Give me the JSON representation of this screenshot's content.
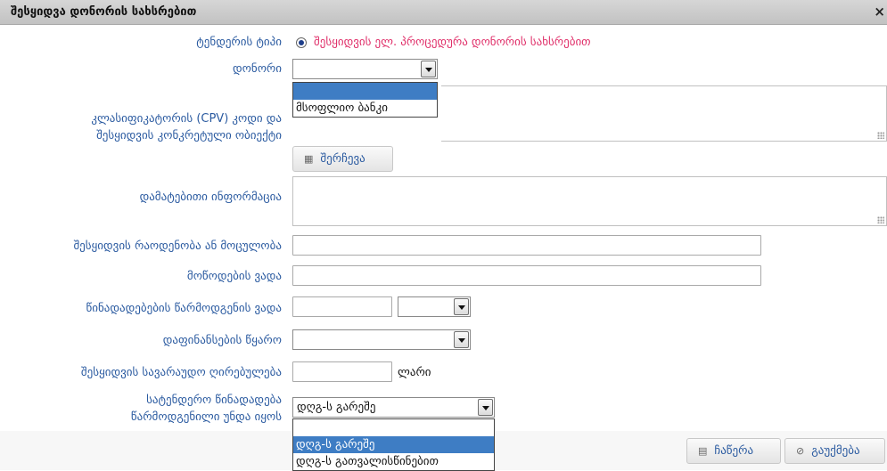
{
  "dialog": {
    "title": "შესყიდვა დონორის სახსრებით",
    "close_glyph": "×"
  },
  "form": {
    "tender_type": {
      "label": "ტენდერის ტიპი",
      "value": "შესყიდვის ელ. პროცედურა დონორის სახსრებით"
    },
    "donor": {
      "label": "დონორი",
      "value": "",
      "options": [
        "",
        "მსოფლიო ბანკი"
      ]
    },
    "cpv": {
      "label_line1": "კლასიფიკატორის (CPV) კოდი და",
      "label_line2": "შესყიდვის კონკრეტული ობიექტი",
      "choose_button": "შერჩევა"
    },
    "additional_info": {
      "label": "დამატებითი ინფორმაცია"
    },
    "quantity": {
      "label": "შესყიდვის რაოდენობა ან მოცულობა",
      "value": ""
    },
    "delivery_term": {
      "label": "მოწოდების ვადა",
      "value": ""
    },
    "proposal_deadline": {
      "label": "წინადადებების წარმოდგენის ვადა",
      "date_value": "",
      "time_value": ""
    },
    "funding_source": {
      "label": "დაფინანსების წყარო",
      "value": ""
    },
    "estimated_value": {
      "label": "შესყიდვის სავარაუდო ღირებულება",
      "value": "",
      "currency": "ლარი"
    },
    "standard_offer": {
      "label_line1": "სატენდერო წინადადება",
      "label_line2": "წარმოდგენილი უნდა იყოს",
      "value": "დღგ-ს გარეშე",
      "options": [
        "",
        "დღგ-ს გარეშე",
        "დღგ-ს გათვალისწინებით"
      ]
    }
  },
  "actions": {
    "save": "ჩაწერა",
    "cancel": "გაუქმება"
  },
  "colors": {
    "label": "#2a5aa0",
    "radio_value": "#e0306a",
    "selected_option": "#3e7dc4"
  }
}
